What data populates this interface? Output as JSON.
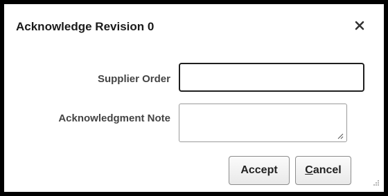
{
  "dialog": {
    "title": "Acknowledge Revision 0",
    "close_icon": "close-icon"
  },
  "form": {
    "supplier_order": {
      "label": "Supplier Order",
      "value": ""
    },
    "acknowledgment_note": {
      "label": "Acknowledgment Note",
      "value": ""
    }
  },
  "buttons": {
    "accept_label": "Accept",
    "cancel_label": "Cancel",
    "cancel_mnemonic": "C",
    "cancel_rest": "ancel"
  },
  "colors": {
    "frame": "#000000",
    "dialog_background": "#ffffff",
    "label_text": "#444444",
    "focused_border": "#1f1f1f"
  }
}
